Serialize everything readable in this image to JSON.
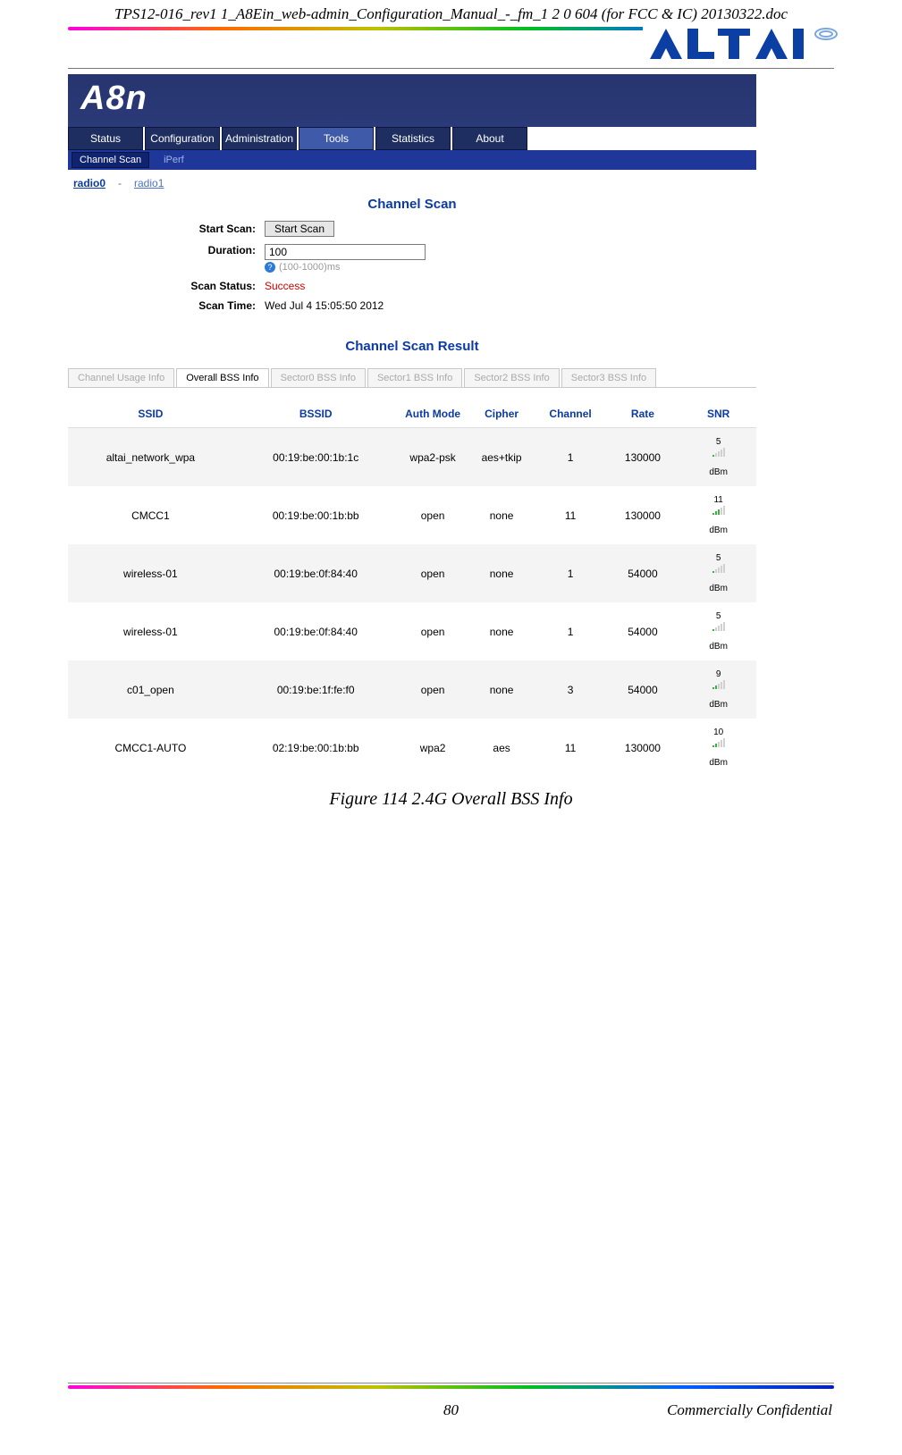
{
  "doc": {
    "header": "TPS12-016_rev1 1_A8Ein_web-admin_Configuration_Manual_-_fm_1 2 0 604 (for FCC & IC) 20130322.doc",
    "figure_caption": "Figure 114 2.4G Overall BSS Info",
    "page_number": "80",
    "footer_right": "Commercially Confidential",
    "logo_text": "ALTAI"
  },
  "app": {
    "brand": "A8n",
    "menu": [
      "Status",
      "Configuration",
      "Administration",
      "Tools",
      "Statistics",
      "About"
    ],
    "submenu": {
      "selected": "Channel Scan",
      "other": "iPerf"
    },
    "radios": {
      "r0": "radio0",
      "dash": "-",
      "r1": "radio1"
    },
    "section_scan": "Channel Scan",
    "section_result": "Channel Scan Result",
    "form": {
      "start_label": "Start Scan:",
      "start_btn": "Start Scan",
      "duration_label": "Duration:",
      "duration_value": "100",
      "duration_hint": "(100-1000)ms",
      "status_label": "Scan Status:",
      "status_value": "Success",
      "time_label": "Scan Time:",
      "time_value": "Wed Jul 4 15:05:50 2012"
    },
    "result_tabs": [
      "Channel Usage Info",
      "Overall BSS Info",
      "Sector0 BSS Info",
      "Sector1 BSS Info",
      "Sector2 BSS Info",
      "Sector3 BSS Info"
    ],
    "result_tabs_active_index": 1,
    "table": {
      "headers": [
        "SSID",
        "BSSID",
        "Auth Mode",
        "Cipher",
        "Channel",
        "Rate",
        "SNR"
      ],
      "rows": [
        {
          "ssid": "altai_network_wpa",
          "bssid": "00:19:be:00:1b:1c",
          "auth": "wpa2-psk",
          "cipher": "aes+tkip",
          "channel": "1",
          "rate": "130000",
          "snr": "5",
          "unit": "dBm",
          "alt": true
        },
        {
          "ssid": "CMCC1",
          "bssid": "00:19:be:00:1b:bb",
          "auth": "open",
          "cipher": "none",
          "channel": "11",
          "rate": "130000",
          "snr": "11",
          "unit": "dBm",
          "alt": false
        },
        {
          "ssid": "wireless-01",
          "bssid": "00:19:be:0f:84:40",
          "auth": "open",
          "cipher": "none",
          "channel": "1",
          "rate": "54000",
          "snr": "5",
          "unit": "dBm",
          "alt": true
        },
        {
          "ssid": "wireless-01",
          "bssid": "00:19:be:0f:84:40",
          "auth": "open",
          "cipher": "none",
          "channel": "1",
          "rate": "54000",
          "snr": "5",
          "unit": "dBm",
          "alt": false
        },
        {
          "ssid": "c01_open",
          "bssid": "00:19:be:1f:fe:f0",
          "auth": "open",
          "cipher": "none",
          "channel": "3",
          "rate": "54000",
          "snr": "9",
          "unit": "dBm",
          "alt": true
        },
        {
          "ssid": "CMCC1-AUTO",
          "bssid": "02:19:be:00:1b:bb",
          "auth": "wpa2",
          "cipher": "aes",
          "channel": "11",
          "rate": "130000",
          "snr": "10",
          "unit": "dBm",
          "alt": false
        }
      ]
    }
  }
}
